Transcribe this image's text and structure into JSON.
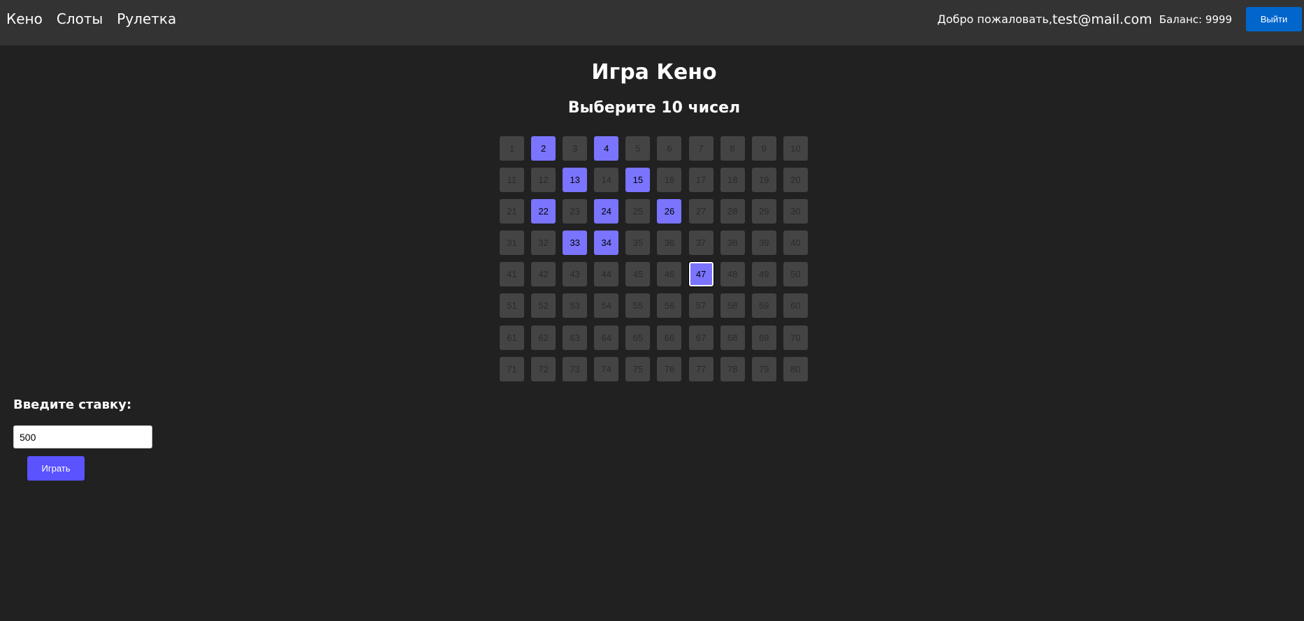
{
  "nav": {
    "links": [
      "Кено",
      "Слоты",
      "Рулетка"
    ],
    "welcome": "Добро пожаловать,",
    "email": "test@mail.com",
    "balance": "Баланс: 9999",
    "logout_label": "Выйти"
  },
  "game": {
    "title": "Игра Кено",
    "subtitle": "Выберите 10 чисел",
    "total_numbers": 80,
    "selected": [
      2,
      4,
      13,
      15,
      22,
      24,
      26,
      33,
      34,
      47
    ],
    "focused": 47
  },
  "bet": {
    "label": "Введите ставку:",
    "value": "500",
    "play_label": "Играть"
  },
  "colors": {
    "background": "#212121",
    "navbar": "#333333",
    "cell": "#444444",
    "selected": "#7a74ff",
    "play_button": "#5a53ff",
    "logout_button": "#0066cc"
  }
}
